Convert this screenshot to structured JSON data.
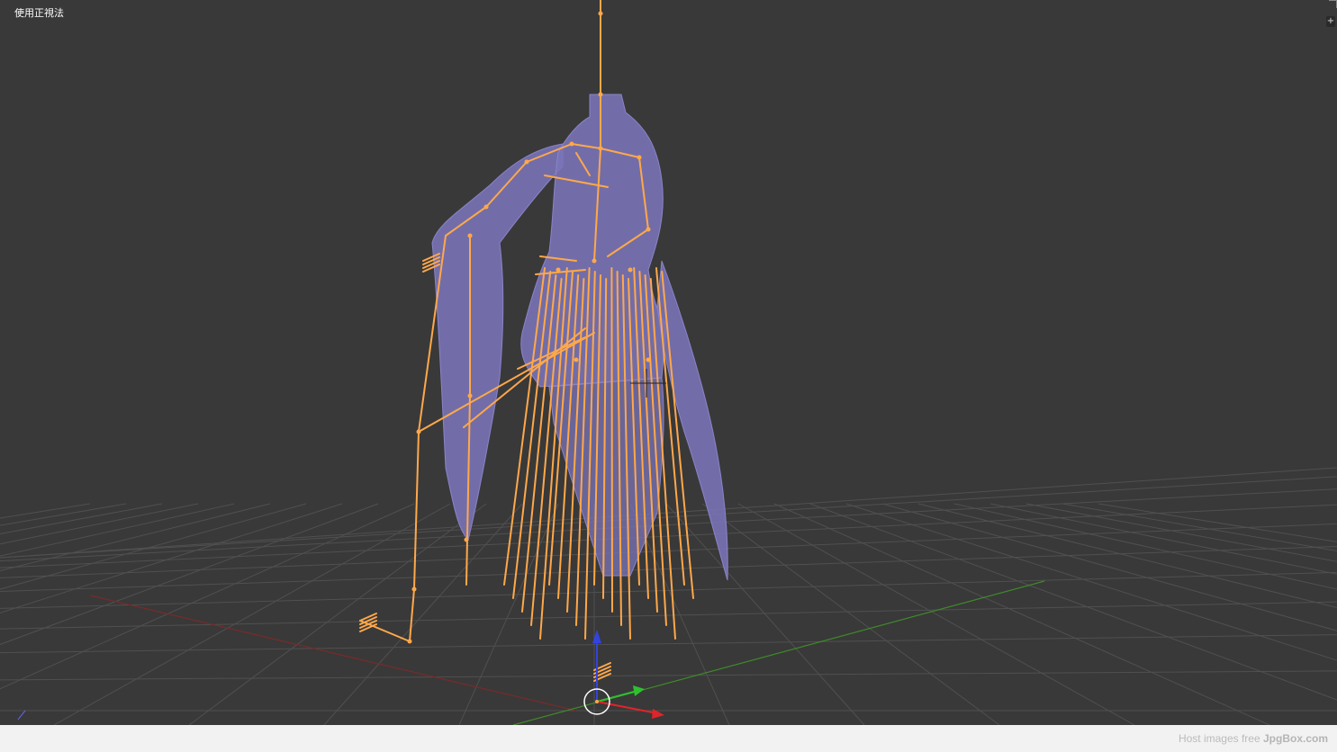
{
  "viewport": {
    "view_label": "使用正視法",
    "corner_button_icon": "plus-icon",
    "background_color": "#393939",
    "grid_color": "#505050",
    "x_axis_color": "#7a2a2a",
    "y_axis_color": "#3f8a2a",
    "mesh_color": "#7a74b8",
    "bone_color": "#ffa84a",
    "gizmo_colors": {
      "x": "#e0242a",
      "y": "#2fbf2f",
      "z": "#3344dd"
    }
  },
  "watermark": {
    "prefix": "Host images free",
    "brand": "JpgBox.com"
  }
}
